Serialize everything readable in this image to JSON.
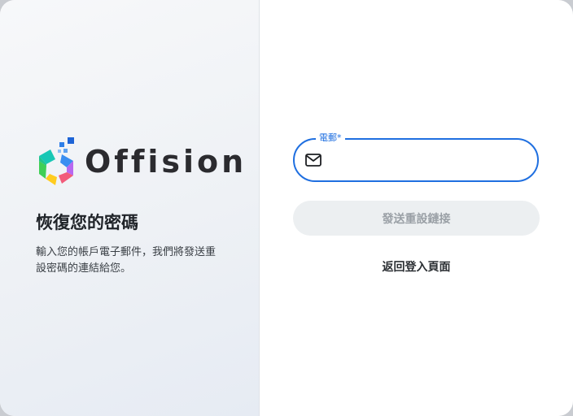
{
  "brand": {
    "name": "Offision",
    "logo_icon": "offision-hexagon-logo-icon"
  },
  "intro": {
    "title": "恢復您的密碼",
    "description": "輸入您的帳戶電子郵件，我們將發送重設密碼的連結給您。"
  },
  "form": {
    "email_label": "電郵",
    "required_mark": "*",
    "email_value": "",
    "email_icon": "mail-icon",
    "send_button_label": "發送重設鏈接",
    "back_link_label": "返回登入頁面"
  },
  "colors": {
    "accent": "#1f6fe0",
    "button_disabled_bg": "#eceff1",
    "button_disabled_text": "#9aa0a6"
  }
}
